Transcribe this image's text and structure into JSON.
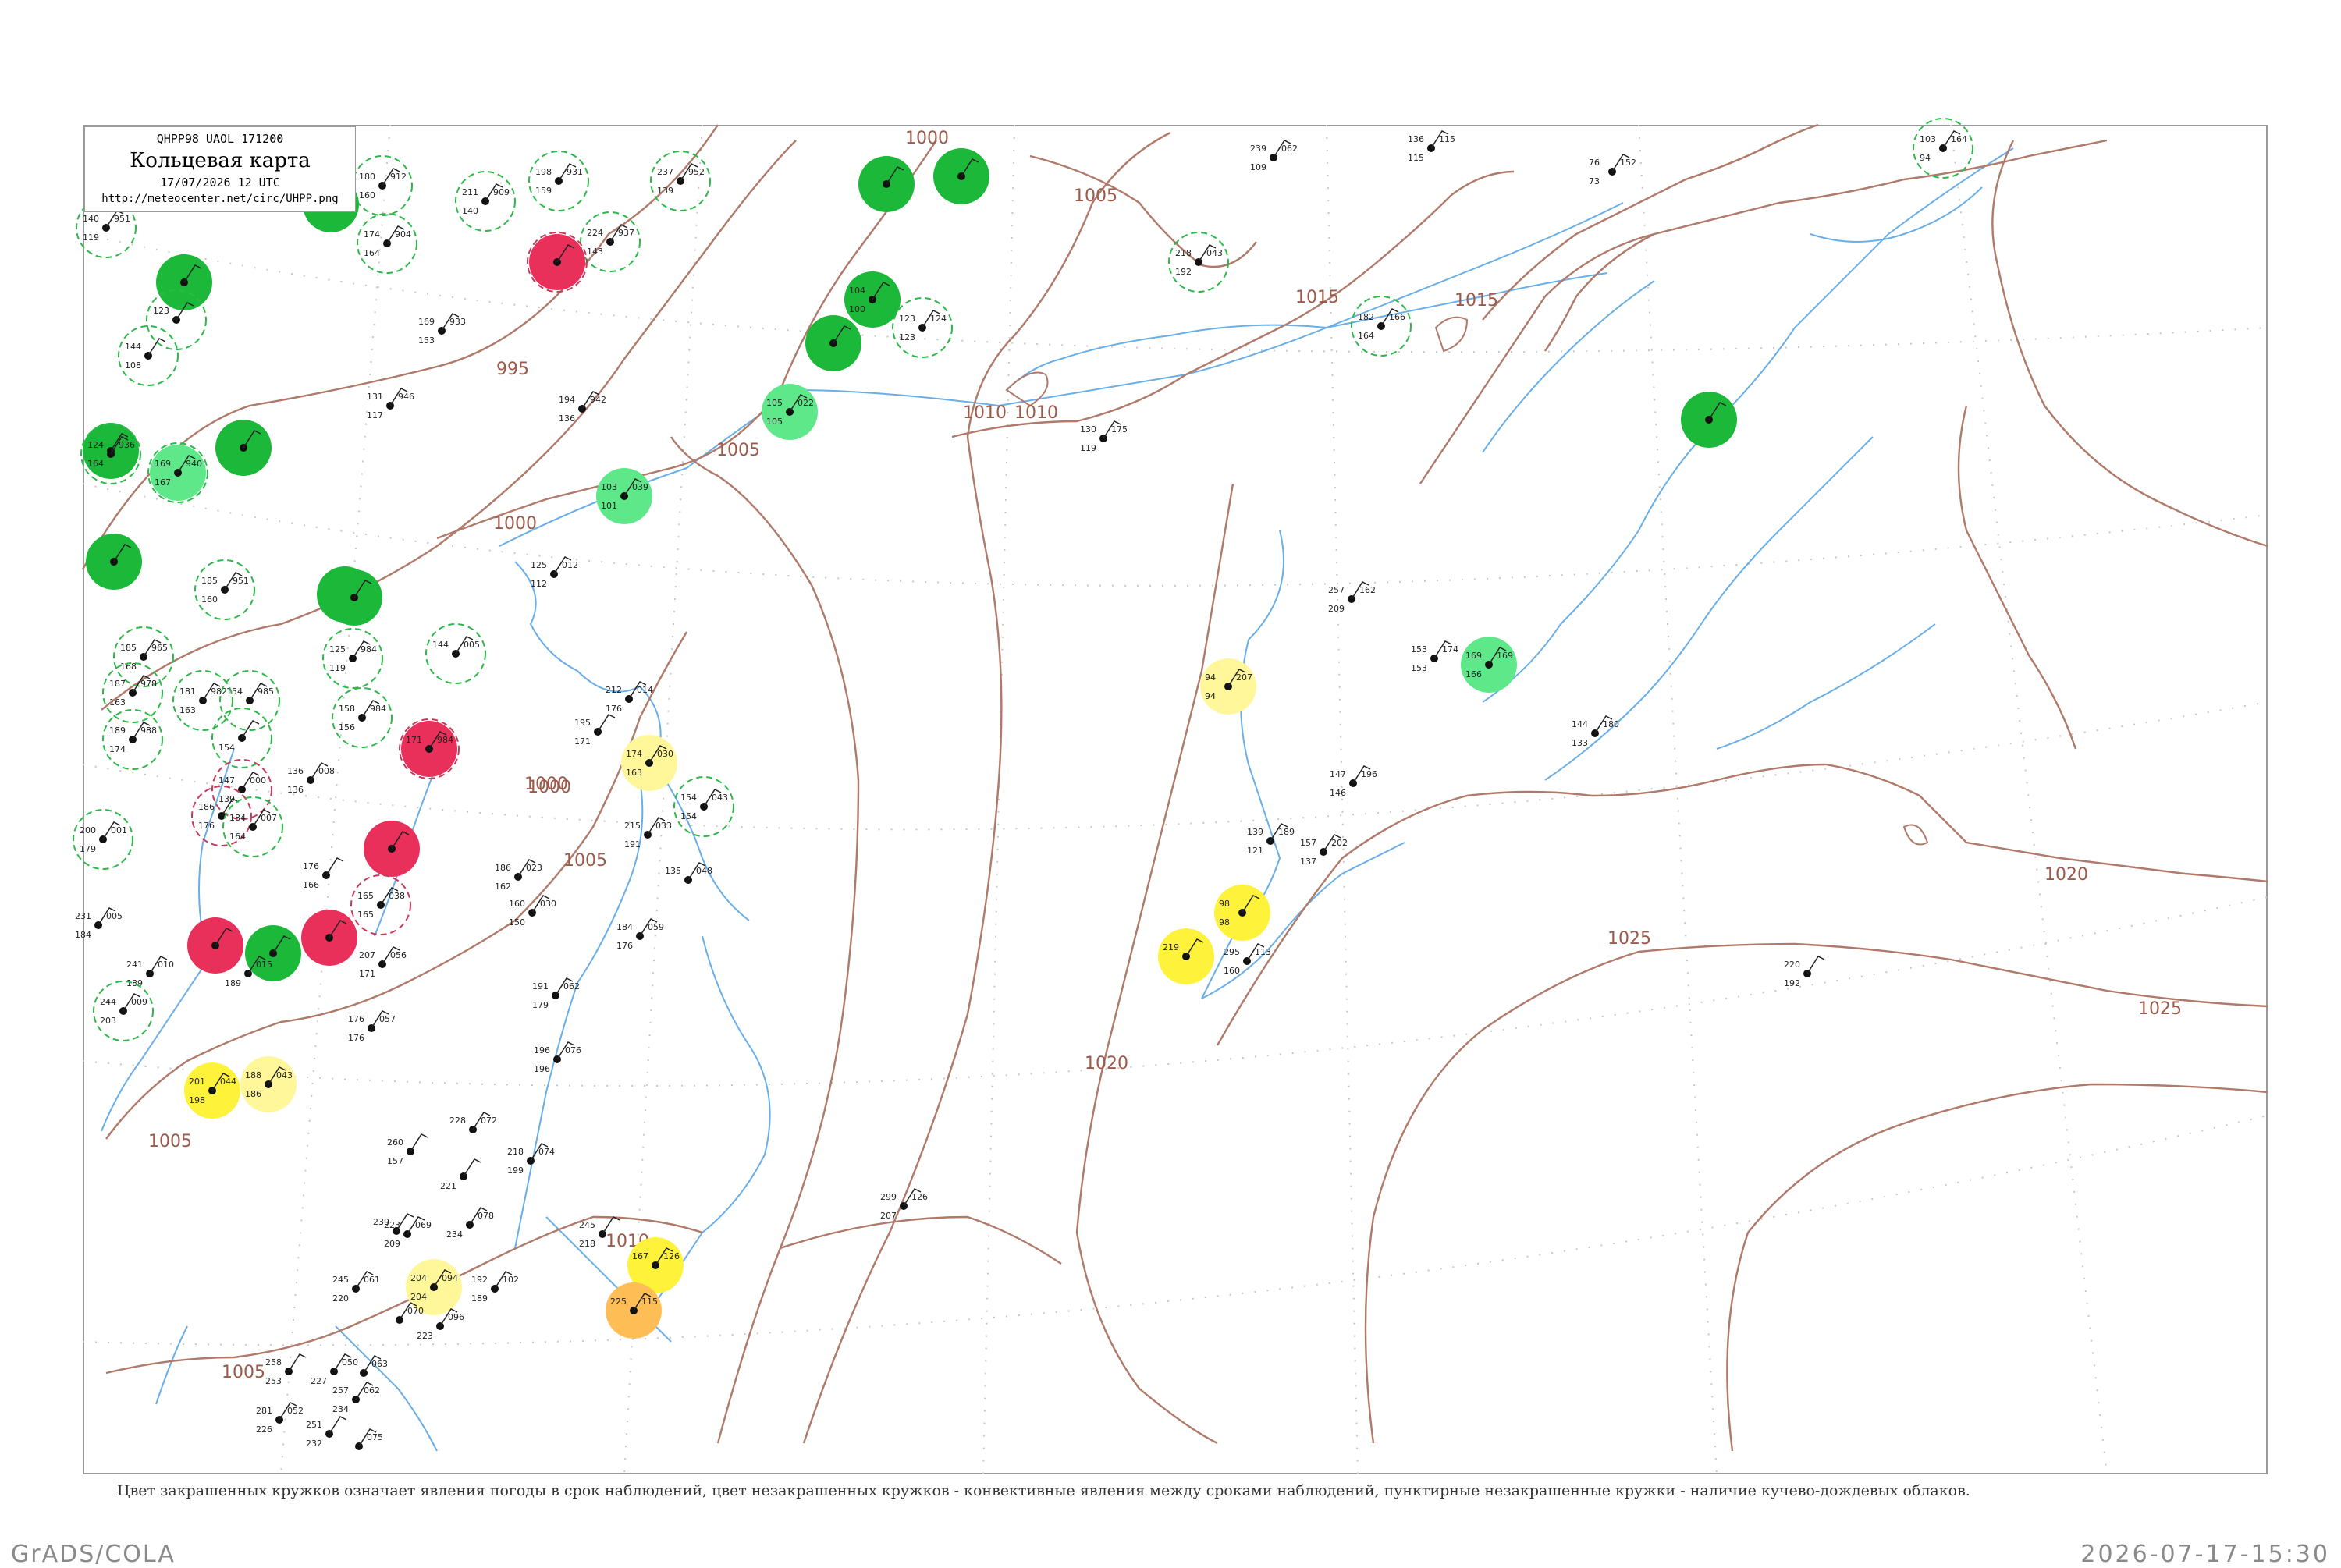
{
  "header": {
    "code": "QHPP98  UAOL  171200",
    "title": "Кольцевая карта",
    "date": "17/07/2026 12 UTC",
    "url": "http://meteocenter.net/circ/UHPP.png"
  },
  "caption": "Цвет закрашенных кружков означает явления погоды в срок наблюдений, цвет незакрашенных кружков - конвективные явления между сроками наблюдений, пунктирные незакрашенные кружки - наличие кучево-дождевых облаков.",
  "footer": {
    "left": "GrADS/COLA",
    "right": "2026-07-17-15:30"
  },
  "colors": {
    "isobar": "#b07a6a",
    "water": "#6aaee8",
    "grid": "#c8c8c8",
    "green_dark": "#1cb83a",
    "green_light": "#5fe88a",
    "red": "#e8305a",
    "yellow": "#fff23a",
    "yellow_light": "#fff79a",
    "orange": "#ffbe55",
    "dashed_green": "#2eb84a",
    "dashed_red": "#c83a5a"
  },
  "isobar_labels": [
    {
      "text": "1000"
    },
    {
      "text": "1005"
    },
    {
      "text": "995"
    },
    {
      "text": "1000"
    },
    {
      "text": "1005"
    },
    {
      "text": "1010"
    },
    {
      "text": "1010"
    },
    {
      "text": "1015"
    },
    {
      "text": "1000"
    },
    {
      "text": "1005"
    },
    {
      "text": "1000"
    },
    {
      "text": "1005"
    },
    {
      "text": "1010"
    },
    {
      "text": "1015"
    },
    {
      "text": "1020"
    },
    {
      "text": "1025"
    },
    {
      "text": "1020"
    },
    {
      "text": "1025"
    },
    {
      "text": "1005"
    }
  ],
  "stations": [
    {
      "t": "180",
      "p": "912",
      "d": "160",
      "fill": "none",
      "ring": "dashed_green"
    },
    {
      "t": "211",
      "p": "909",
      "d": "140",
      "fill": "none",
      "ring": "dashed_green"
    },
    {
      "t": "198",
      "p": "931",
      "d": "159",
      "fill": "none",
      "ring": "dashed_green"
    },
    {
      "t": "237",
      "p": "952",
      "d": "139",
      "fill": "none",
      "ring": "dashed_green"
    },
    {
      "t": "140",
      "p": "951",
      "d": "119",
      "fill": "none",
      "ring": "dashed_green"
    },
    {
      "t": "174",
      "p": "904",
      "d": "164",
      "fill": "none",
      "ring": "dashed_green"
    },
    {
      "t": "224",
      "p": "937",
      "d": "143",
      "fill": "none",
      "ring": "dashed_green"
    },
    {
      "t": "",
      "p": "",
      "d": "",
      "fill": "red",
      "ring": "dashed_red"
    },
    {
      "t": "",
      "p": "",
      "d": "",
      "fill": "green_dark",
      "ring": "none"
    },
    {
      "t": "",
      "p": "",
      "d": "",
      "fill": "green_dark",
      "ring": "none"
    },
    {
      "t": "123",
      "p": "",
      "d": "",
      "fill": "none",
      "ring": "dashed_green"
    },
    {
      "t": "144",
      "p": "",
      "d": "108",
      "fill": "none",
      "ring": "dashed_green"
    },
    {
      "t": "169",
      "p": "933",
      "d": "153",
      "fill": "none",
      "ring": "none"
    },
    {
      "t": "",
      "p": "",
      "d": "",
      "fill": "green_dark",
      "ring": "none"
    },
    {
      "t": "",
      "p": "",
      "d": "",
      "fill": "green_dark",
      "ring": "none"
    },
    {
      "t": "",
      "p": "",
      "d": "",
      "fill": "green_dark",
      "ring": "none"
    },
    {
      "t": "131",
      "p": "946",
      "d": "117",
      "fill": "none",
      "ring": "none"
    },
    {
      "t": "194",
      "p": "942",
      "d": "136",
      "fill": "none",
      "ring": "none"
    },
    {
      "t": "105",
      "p": "022",
      "d": "105",
      "fill": "green_light",
      "ring": "none"
    },
    {
      "t": "124",
      "p": "936",
      "d": "164",
      "fill": "none",
      "ring": "dashed_green"
    },
    {
      "t": "169",
      "p": "940",
      "d": "167",
      "fill": "green_light",
      "ring": "dashed_green"
    },
    {
      "t": "",
      "p": "",
      "d": "",
      "fill": "green_dark",
      "ring": "none"
    },
    {
      "t": "103",
      "p": "039",
      "d": "101",
      "fill": "green_light",
      "ring": "none"
    },
    {
      "t": "",
      "p": "",
      "d": "",
      "fill": "green_dark",
      "ring": "none"
    },
    {
      "t": "185",
      "p": "951",
      "d": "160",
      "fill": "none",
      "ring": "dashed_green"
    },
    {
      "t": "125",
      "p": "012",
      "d": "112",
      "fill": "none",
      "ring": "none"
    },
    {
      "t": "",
      "p": "",
      "d": "",
      "fill": "green_dark",
      "ring": "none"
    },
    {
      "t": "125",
      "p": "984",
      "d": "119",
      "fill": "none",
      "ring": "dashed_green"
    },
    {
      "t": "144",
      "p": "005",
      "d": "",
      "fill": "none",
      "ring": "dashed_green"
    },
    {
      "t": "185",
      "p": "965",
      "d": "168",
      "fill": "none",
      "ring": "dashed_green"
    },
    {
      "t": "187",
      "p": "978",
      "d": "163",
      "fill": "none",
      "ring": "dashed_green"
    },
    {
      "t": "181",
      "p": "982",
      "d": "163",
      "fill": "none",
      "ring": "dashed_green"
    },
    {
      "t": "154",
      "p": "985",
      "d": "",
      "fill": "none",
      "ring": "dashed_green"
    },
    {
      "t": "158",
      "p": "984",
      "d": "156",
      "fill": "none",
      "ring": "dashed_green"
    },
    {
      "t": "189",
      "p": "988",
      "d": "174",
      "fill": "none",
      "ring": "dashed_green"
    },
    {
      "t": "",
      "p": "",
      "d": "154",
      "fill": "none",
      "ring": "dashed_green"
    },
    {
      "t": "171",
      "p": "984",
      "d": "",
      "fill": "red",
      "ring": "dashed_red"
    },
    {
      "t": "212",
      "p": "014",
      "d": "176",
      "fill": "none",
      "ring": "none"
    },
    {
      "t": "174",
      "p": "030",
      "d": "163",
      "fill": "yellow_light",
      "ring": "none"
    },
    {
      "t": "195",
      "p": "",
      "d": "171",
      "fill": "none",
      "ring": "none"
    },
    {
      "t": "136",
      "p": "008",
      "d": "136",
      "fill": "none",
      "ring": "none"
    },
    {
      "t": "147",
      "p": "000",
      "d": "139",
      "fill": "none",
      "ring": "dashed_red"
    },
    {
      "t": "154",
      "p": "043",
      "d": "154",
      "fill": "none",
      "ring": "dashed_green"
    },
    {
      "t": "186",
      "p": "",
      "d": "176",
      "fill": "none",
      "ring": "dashed_red"
    },
    {
      "t": "184",
      "p": "007",
      "d": "164",
      "fill": "none",
      "ring": "dashed_green"
    },
    {
      "t": "200",
      "p": "001",
      "d": "179",
      "fill": "none",
      "ring": "dashed_green"
    },
    {
      "t": "",
      "p": "",
      "d": "",
      "fill": "red",
      "ring": "none"
    },
    {
      "t": "176",
      "p": "",
      "d": "166",
      "fill": "none",
      "ring": "none"
    },
    {
      "t": "215",
      "p": "033",
      "d": "191",
      "fill": "none",
      "ring": "none"
    },
    {
      "t": "165",
      "p": "038",
      "d": "165",
      "fill": "none",
      "ring": "dashed_red"
    },
    {
      "t": "186",
      "p": "023",
      "d": "162",
      "fill": "none",
      "ring": "none"
    },
    {
      "t": "135",
      "p": "048",
      "d": "",
      "fill": "none",
      "ring": "none"
    },
    {
      "t": "160",
      "p": "030",
      "d": "150",
      "fill": "none",
      "ring": "none"
    },
    {
      "t": "231",
      "p": "005",
      "d": "184",
      "fill": "none",
      "ring": "none"
    },
    {
      "t": "",
      "p": "",
      "d": "",
      "fill": "red",
      "ring": "none"
    },
    {
      "t": "",
      "p": "",
      "d": "",
      "fill": "red",
      "ring": "none"
    },
    {
      "t": "184",
      "p": "059",
      "d": "176",
      "fill": "none",
      "ring": "none"
    },
    {
      "t": "241",
      "p": "010",
      "d": "189",
      "fill": "none",
      "ring": "none"
    },
    {
      "t": "",
      "p": "015",
      "d": "189",
      "fill": "none",
      "ring": "none"
    },
    {
      "t": "207",
      "p": "056",
      "d": "171",
      "fill": "none",
      "ring": "none"
    },
    {
      "t": "191",
      "p": "062",
      "d": "179",
      "fill": "none",
      "ring": "none"
    },
    {
      "t": "244",
      "p": "009",
      "d": "203",
      "fill": "none",
      "ring": "dashed_green"
    },
    {
      "t": "176",
      "p": "057",
      "d": "176",
      "fill": "none",
      "ring": "none"
    },
    {
      "t": "201",
      "p": "044",
      "d": "198",
      "fill": "yellow",
      "ring": "none"
    },
    {
      "t": "188",
      "p": "043",
      "d": "186",
      "fill": "yellow_light",
      "ring": "none"
    },
    {
      "t": "196",
      "p": "076",
      "d": "196",
      "fill": "none",
      "ring": "none"
    },
    {
      "t": "260",
      "p": "",
      "d": "157",
      "fill": "none",
      "ring": "none"
    },
    {
      "t": "228",
      "p": "072",
      "d": "",
      "fill": "none",
      "ring": "none"
    },
    {
      "t": "",
      "p": "",
      "d": "221",
      "fill": "none",
      "ring": "none"
    },
    {
      "t": "218",
      "p": "074",
      "d": "199",
      "fill": "none",
      "ring": "none"
    },
    {
      "t": "",
      "p": "078",
      "d": "234",
      "fill": "none",
      "ring": "none"
    },
    {
      "t": "245",
      "p": "",
      "d": "218",
      "fill": "none",
      "ring": "none"
    },
    {
      "t": "167",
      "p": "126",
      "d": "",
      "fill": "yellow",
      "ring": "none"
    },
    {
      "t": "225",
      "p": "115",
      "d": "",
      "fill": "orange",
      "ring": "none"
    },
    {
      "t": "223",
      "p": "069",
      "d": "209",
      "fill": "none",
      "ring": "none"
    },
    {
      "t": "239",
      "p": "",
      "d": "",
      "fill": "none",
      "ring": "none"
    },
    {
      "t": "204",
      "p": "094",
      "d": "204",
      "fill": "yellow_light",
      "ring": "none"
    },
    {
      "t": "245",
      "p": "061",
      "d": "220",
      "fill": "none",
      "ring": "none"
    },
    {
      "t": "",
      "p": "070",
      "d": "",
      "fill": "none",
      "ring": "none"
    },
    {
      "t": "",
      "p": "096",
      "d": "223",
      "fill": "none",
      "ring": "none"
    },
    {
      "t": "192",
      "p": "102",
      "d": "189",
      "fill": "none",
      "ring": "none"
    },
    {
      "t": "258",
      "p": "",
      "d": "253",
      "fill": "none",
      "ring": "none"
    },
    {
      "t": "",
      "p": "050",
      "d": "227",
      "fill": "none",
      "ring": "none"
    },
    {
      "t": "",
      "p": "063",
      "d": "",
      "fill": "none",
      "ring": "none"
    },
    {
      "t": "281",
      "p": "052",
      "d": "226",
      "fill": "none",
      "ring": "none"
    },
    {
      "t": "251",
      "p": "",
      "d": "232",
      "fill": "none",
      "ring": "none"
    },
    {
      "t": "257",
      "p": "062",
      "d": "234",
      "fill": "none",
      "ring": "none"
    },
    {
      "t": "",
      "p": "075",
      "d": "",
      "fill": "none",
      "ring": "none"
    },
    {
      "t": "239",
      "p": "062",
      "d": "109",
      "fill": "none",
      "ring": "none"
    },
    {
      "t": "136",
      "p": "115",
      "d": "115",
      "fill": "none",
      "ring": "none"
    },
    {
      "t": "76",
      "p": "152",
      "d": "73",
      "fill": "none",
      "ring": "none"
    },
    {
      "t": "103",
      "p": "164",
      "d": "94",
      "fill": "none",
      "ring": "dashed_green"
    },
    {
      "t": "218",
      "p": "043",
      "d": "192",
      "fill": "none",
      "ring": "dashed_green"
    },
    {
      "t": "",
      "p": "",
      "d": "",
      "fill": "green_dark",
      "ring": "none"
    },
    {
      "t": "",
      "p": "",
      "d": "",
      "fill": "green_dark",
      "ring": "none"
    },
    {
      "t": "104",
      "p": "",
      "d": "100",
      "fill": "green_dark",
      "ring": "none"
    },
    {
      "t": "",
      "p": "",
      "d": "",
      "fill": "green_dark",
      "ring": "none"
    },
    {
      "t": "123",
      "p": "124",
      "d": "123",
      "fill": "none",
      "ring": "dashed_green"
    },
    {
      "t": "130",
      "p": "175",
      "d": "119",
      "fill": "none",
      "ring": "none"
    },
    {
      "t": "",
      "p": "",
      "d": "",
      "fill": "green_dark",
      "ring": "none"
    },
    {
      "t": "182",
      "p": "166",
      "d": "164",
      "fill": "none",
      "ring": "dashed_green"
    },
    {
      "t": "257",
      "p": "162",
      "d": "209",
      "fill": "none",
      "ring": "none"
    },
    {
      "t": "153",
      "p": "174",
      "d": "153",
      "fill": "none",
      "ring": "none"
    },
    {
      "t": "169",
      "p": "169",
      "d": "166",
      "fill": "green_light",
      "ring": "none"
    },
    {
      "t": "94",
      "p": "207",
      "d": "94",
      "fill": "yellow_light",
      "ring": "none"
    },
    {
      "t": "144",
      "p": "180",
      "d": "133",
      "fill": "none",
      "ring": "none"
    },
    {
      "t": "147",
      "p": "196",
      "d": "146",
      "fill": "none",
      "ring": "none"
    },
    {
      "t": "139",
      "p": "189",
      "d": "121",
      "fill": "none",
      "ring": "none"
    },
    {
      "t": "157",
      "p": "202",
      "d": "137",
      "fill": "none",
      "ring": "none"
    },
    {
      "t": "98",
      "p": "",
      "d": "98",
      "fill": "yellow",
      "ring": "none"
    },
    {
      "t": "219",
      "p": "",
      "d": "",
      "fill": "yellow",
      "ring": "none"
    },
    {
      "t": "295",
      "p": "113",
      "d": "160",
      "fill": "none",
      "ring": "none"
    },
    {
      "t": "220",
      "p": "",
      "d": "192",
      "fill": "none",
      "ring": "none"
    },
    {
      "t": "299",
      "p": "126",
      "d": "207",
      "fill": "none",
      "ring": "none"
    }
  ]
}
